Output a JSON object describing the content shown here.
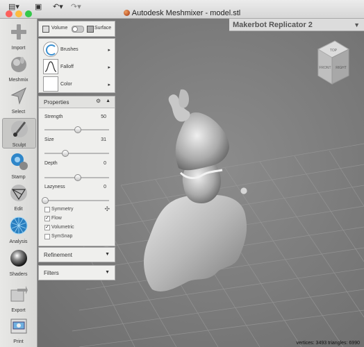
{
  "window": {
    "title": "Autodesk Meshmixer - model.stl",
    "traffic_colors": [
      "#fc605c",
      "#fdbc40",
      "#34c84a"
    ]
  },
  "toolbar": {
    "items": [
      {
        "label": "Import",
        "icon": "plus-icon"
      },
      {
        "label": "Meshmix",
        "icon": "meshmix-bunny-icon"
      },
      {
        "label": "Select",
        "icon": "cursor-arrow-icon"
      },
      {
        "label": "Sculpt",
        "icon": "brush-icon",
        "active": true
      },
      {
        "label": "Stamp",
        "icon": "stamp-icon"
      },
      {
        "label": "Edit",
        "icon": "edit-mesh-icon"
      },
      {
        "label": "Analysis",
        "icon": "analysis-globe-icon"
      },
      {
        "label": "Shaders",
        "icon": "shader-sphere-icon"
      },
      {
        "label": "Export",
        "icon": "export-arrow-icon"
      },
      {
        "label": "Print",
        "icon": "printer-icon"
      }
    ]
  },
  "sculpt_mode": {
    "volume_label": "Volume",
    "surface_label": "Surface"
  },
  "brush_menu": {
    "brushes_label": "Brushes",
    "falloff_label": "Falloff",
    "color_label": "Color"
  },
  "properties": {
    "title": "Properties",
    "strength": {
      "label": "Strength",
      "value": "50",
      "fraction": 0.5
    },
    "size": {
      "label": "Size",
      "value": "31",
      "fraction": 0.31
    },
    "depth": {
      "label": "Depth",
      "value": "0",
      "fraction": 0.5
    },
    "lazyness": {
      "label": "Lazyness",
      "value": "0",
      "fraction": 0.0
    },
    "symmetry": {
      "label": "Symmetry",
      "checked": false
    },
    "flow": {
      "label": "Flow",
      "checked": true
    },
    "volumetric": {
      "label": "Volumetric",
      "checked": true
    },
    "symsnap": {
      "label": "SymSnap",
      "checked": false
    }
  },
  "refinement": {
    "title": "Refinement"
  },
  "filters": {
    "title": "Filters"
  },
  "printer": {
    "name": "Makerbot Replicator 2"
  },
  "viewcube": {
    "top": "TOP",
    "front": "FRONT",
    "right": "RIGHT"
  },
  "status": {
    "text": "vertices: 3493 triangles: 6990"
  }
}
